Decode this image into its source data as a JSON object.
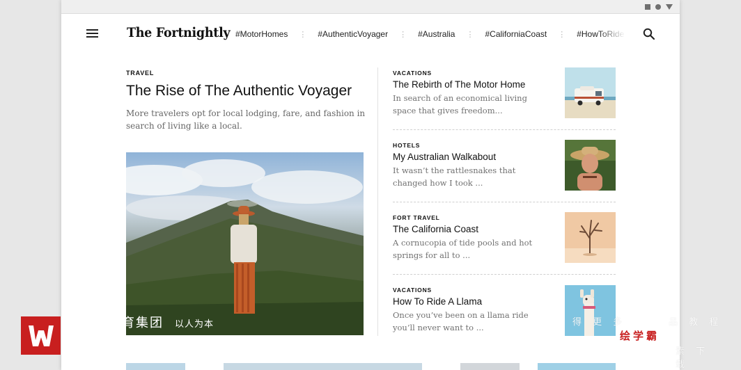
{
  "brand": {
    "logo": "The Fortnightly"
  },
  "nav": {
    "tags": [
      "#MotorHomes",
      "#AuthenticVoyager",
      "#Australia",
      "#CaliforniaCoast",
      "#HowToRide/"
    ]
  },
  "feature": {
    "category": "TRAVEL",
    "title": "The Rise of The Authentic Voyager",
    "description": "More travelers opt for local lodging, fare, and fashion in search of living like a local.",
    "overlay_text": "育集团",
    "overlay_subtext": "以人为本"
  },
  "articles": [
    {
      "category": "VACATIONS",
      "title": "The Rebirth of The Motor Home",
      "description": "In search of an economical living space that gives freedom...",
      "thumb_icon": "motorhome-photo"
    },
    {
      "category": "HOTELS",
      "title": "My Australian Walkabout",
      "description": "It wasn’t the rattlesnakes  that changed how I took ...",
      "thumb_icon": "portrait-photo"
    },
    {
      "category": "FORT TRAVEL",
      "title": "The California Coast",
      "description": "A cornucopia of tide pools and hot springs for all to ...",
      "thumb_icon": "desert-tree-photo"
    },
    {
      "category": "VACATIONS",
      "title": "How To Ride A Llama",
      "description": "Once you’ve been on a llama ride you’ll never want to ...",
      "thumb_icon": "llama-photo"
    }
  ],
  "watermark": {
    "text": "绘学霸"
  },
  "colors": {
    "accent": "#c81f1f",
    "text": "#111111",
    "muted": "#717171"
  }
}
